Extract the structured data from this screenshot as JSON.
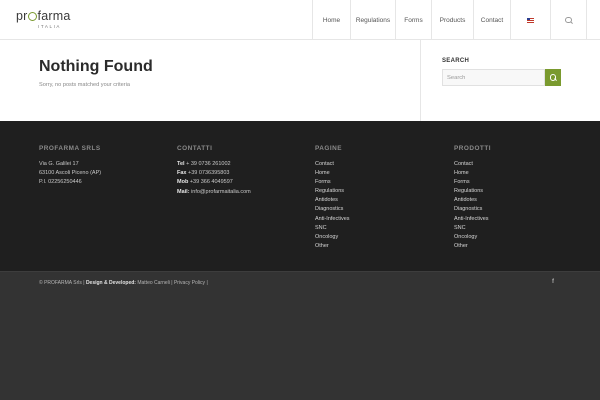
{
  "header": {
    "logo": {
      "brand_prefix": "pr",
      "brand_suffix": "farma",
      "sub": "ITALIA"
    },
    "nav": [
      {
        "label": "Home"
      },
      {
        "label": "Regulations"
      },
      {
        "label": "Forms"
      },
      {
        "label": "Products"
      },
      {
        "label": "Contact"
      }
    ],
    "flag_icon": "us-flag-icon",
    "search_icon": "search-icon"
  },
  "main": {
    "title": "Nothing Found",
    "message": "Sorry, no posts matched your criteria"
  },
  "sidebar": {
    "title": "SEARCH",
    "search_placeholder": "Search",
    "button_color": "#7a9a2e"
  },
  "footer": {
    "company": {
      "title": "PROFARMA SRLS",
      "lines": [
        "Via G. Galilei 17",
        "63100 Ascoli Piceno (AP)",
        "P.I. 02256250446"
      ]
    },
    "contacts": {
      "title": "CONTATTI",
      "tel_label": "Tel",
      "tel": "+ 39 0736 261002",
      "fax_label": "Fax",
      "fax": "+39 0736395803",
      "mob_label": "Mob",
      "mob": "+39 366 4049597",
      "mail_label": "Mail:",
      "mail": "info@profarmaitalia.com"
    },
    "pages": {
      "title": "PAGINE",
      "links": [
        "Contact",
        "Home",
        "Forms",
        "Regulations",
        "Antidotes",
        "Diagnostics",
        "Anti-Infectives",
        "SNC",
        "Oncology",
        "Other"
      ]
    },
    "products": {
      "title": "PRODOTTI",
      "links": [
        "Contact",
        "Home",
        "Forms",
        "Regulations",
        "Antidotes",
        "Diagnostics",
        "Anti-Infectives",
        "SNC",
        "Oncology",
        "Other"
      ]
    }
  },
  "socket": {
    "copyright": "© PROFARMA Srls",
    "design_label": "Design & Developed:",
    "designer": "Matteo Carneli",
    "privacy": "Privacy Policy",
    "facebook": "f"
  }
}
